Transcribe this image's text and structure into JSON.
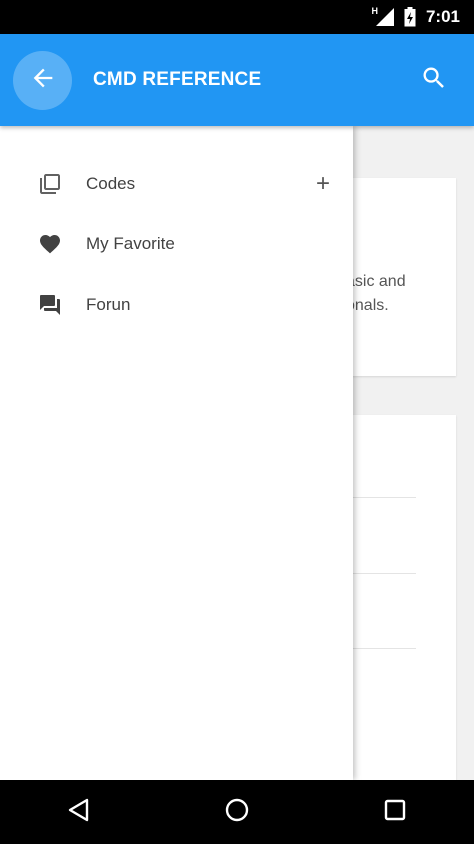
{
  "status_bar": {
    "signal_label": "H",
    "time": "7:01",
    "icons": [
      "signal-icon",
      "battery-charging-icon"
    ]
  },
  "app_bar": {
    "title": "CMD REFERENCE",
    "back_icon": "arrow-back-icon",
    "search_icon": "search-icon",
    "color": "#2196f3"
  },
  "drawer": {
    "items": [
      {
        "label": "Codes",
        "icon": "library-icon",
        "action_icon": "plus-icon",
        "action": "+"
      },
      {
        "label": "My Favorite",
        "icon": "heart-icon"
      },
      {
        "label": "Forun",
        "icon": "forum-icon"
      }
    ]
  },
  "background": {
    "card1_text": "asic and\nonals."
  },
  "nav_bar": {
    "icons": [
      "back-triangle-icon",
      "home-circle-icon",
      "recents-square-icon"
    ]
  }
}
